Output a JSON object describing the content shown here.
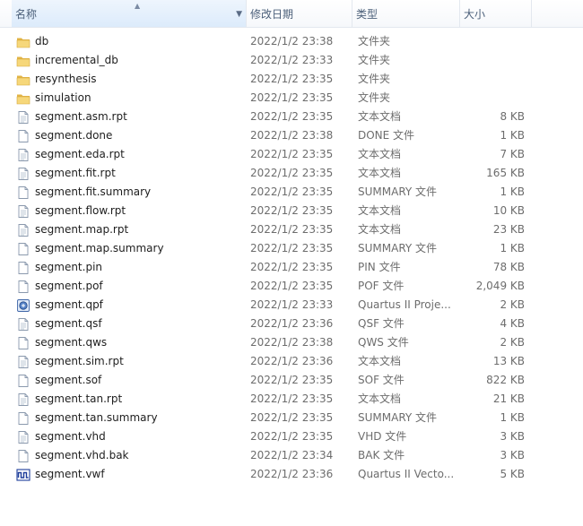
{
  "header": {
    "name": "名称",
    "date": "修改日期",
    "type": "类型",
    "size": "大小"
  },
  "files": [
    {
      "name": "db",
      "date": "2022/1/2 23:38",
      "type": "文件夹",
      "size": "",
      "icon": "folder-icon"
    },
    {
      "name": "incremental_db",
      "date": "2022/1/2 23:33",
      "type": "文件夹",
      "size": "",
      "icon": "folder-icon"
    },
    {
      "name": "resynthesis",
      "date": "2022/1/2 23:35",
      "type": "文件夹",
      "size": "",
      "icon": "folder-icon"
    },
    {
      "name": "simulation",
      "date": "2022/1/2 23:35",
      "type": "文件夹",
      "size": "",
      "icon": "folder-icon"
    },
    {
      "name": "segment.asm.rpt",
      "date": "2022/1/2 23:35",
      "type": "文本文档",
      "size": "8 KB",
      "icon": "text-document-icon"
    },
    {
      "name": "segment.done",
      "date": "2022/1/2 23:38",
      "type": "DONE 文件",
      "size": "1 KB",
      "icon": "blank-file-icon"
    },
    {
      "name": "segment.eda.rpt",
      "date": "2022/1/2 23:35",
      "type": "文本文档",
      "size": "7 KB",
      "icon": "text-document-icon"
    },
    {
      "name": "segment.fit.rpt",
      "date": "2022/1/2 23:35",
      "type": "文本文档",
      "size": "165 KB",
      "icon": "text-document-icon"
    },
    {
      "name": "segment.fit.summary",
      "date": "2022/1/2 23:35",
      "type": "SUMMARY 文件",
      "size": "1 KB",
      "icon": "blank-file-icon"
    },
    {
      "name": "segment.flow.rpt",
      "date": "2022/1/2 23:35",
      "type": "文本文档",
      "size": "10 KB",
      "icon": "text-document-icon"
    },
    {
      "name": "segment.map.rpt",
      "date": "2022/1/2 23:35",
      "type": "文本文档",
      "size": "23 KB",
      "icon": "text-document-icon"
    },
    {
      "name": "segment.map.summary",
      "date": "2022/1/2 23:35",
      "type": "SUMMARY 文件",
      "size": "1 KB",
      "icon": "blank-file-icon"
    },
    {
      "name": "segment.pin",
      "date": "2022/1/2 23:35",
      "type": "PIN 文件",
      "size": "78 KB",
      "icon": "blank-file-icon"
    },
    {
      "name": "segment.pof",
      "date": "2022/1/2 23:35",
      "type": "POF 文件",
      "size": "2,049 KB",
      "icon": "blank-file-icon"
    },
    {
      "name": "segment.qpf",
      "date": "2022/1/2 23:33",
      "type": "Quartus II Proje...",
      "size": "2 KB",
      "icon": "quartus-project-icon"
    },
    {
      "name": "segment.qsf",
      "date": "2022/1/2 23:36",
      "type": "QSF 文件",
      "size": "4 KB",
      "icon": "text-document-icon"
    },
    {
      "name": "segment.qws",
      "date": "2022/1/2 23:38",
      "type": "QWS 文件",
      "size": "2 KB",
      "icon": "blank-file-icon"
    },
    {
      "name": "segment.sim.rpt",
      "date": "2022/1/2 23:36",
      "type": "文本文档",
      "size": "13 KB",
      "icon": "text-document-icon"
    },
    {
      "name": "segment.sof",
      "date": "2022/1/2 23:35",
      "type": "SOF 文件",
      "size": "822 KB",
      "icon": "blank-file-icon"
    },
    {
      "name": "segment.tan.rpt",
      "date": "2022/1/2 23:35",
      "type": "文本文档",
      "size": "21 KB",
      "icon": "text-document-icon"
    },
    {
      "name": "segment.tan.summary",
      "date": "2022/1/2 23:35",
      "type": "SUMMARY 文件",
      "size": "1 KB",
      "icon": "blank-file-icon"
    },
    {
      "name": "segment.vhd",
      "date": "2022/1/2 23:35",
      "type": "VHD 文件",
      "size": "3 KB",
      "icon": "text-document-icon"
    },
    {
      "name": "segment.vhd.bak",
      "date": "2022/1/2 23:34",
      "type": "BAK 文件",
      "size": "3 KB",
      "icon": "blank-file-icon"
    },
    {
      "name": "segment.vwf",
      "date": "2022/1/2 23:36",
      "type": "Quartus II Vecto...",
      "size": "5 KB",
      "icon": "waveform-file-icon"
    }
  ]
}
